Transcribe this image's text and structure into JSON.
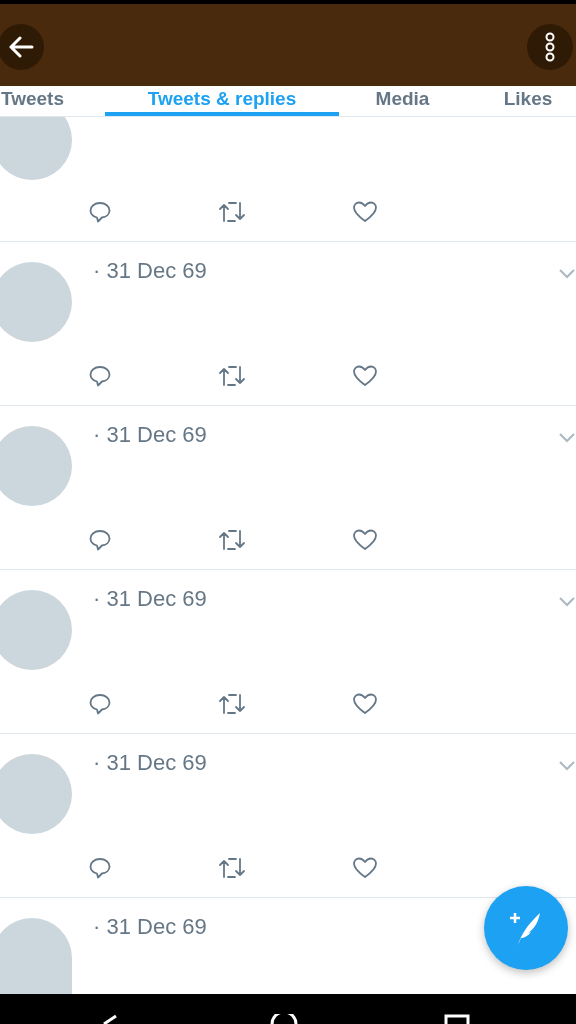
{
  "tabs": [
    {
      "label": "Tweets",
      "selected": false
    },
    {
      "label": "Tweets & replies",
      "selected": true
    },
    {
      "label": "Media",
      "selected": false
    },
    {
      "label": "Likes",
      "selected": false
    }
  ],
  "tweets": [
    {
      "kind": "partial"
    },
    {
      "kind": "full",
      "date": "· 31 Dec 69"
    },
    {
      "kind": "full",
      "date": "· 31 Dec 69"
    },
    {
      "kind": "full",
      "date": "· 31 Dec 69"
    },
    {
      "kind": "full",
      "date": "· 31 Dec 69"
    },
    {
      "kind": "cut",
      "date": "· 31 Dec 69"
    }
  ]
}
